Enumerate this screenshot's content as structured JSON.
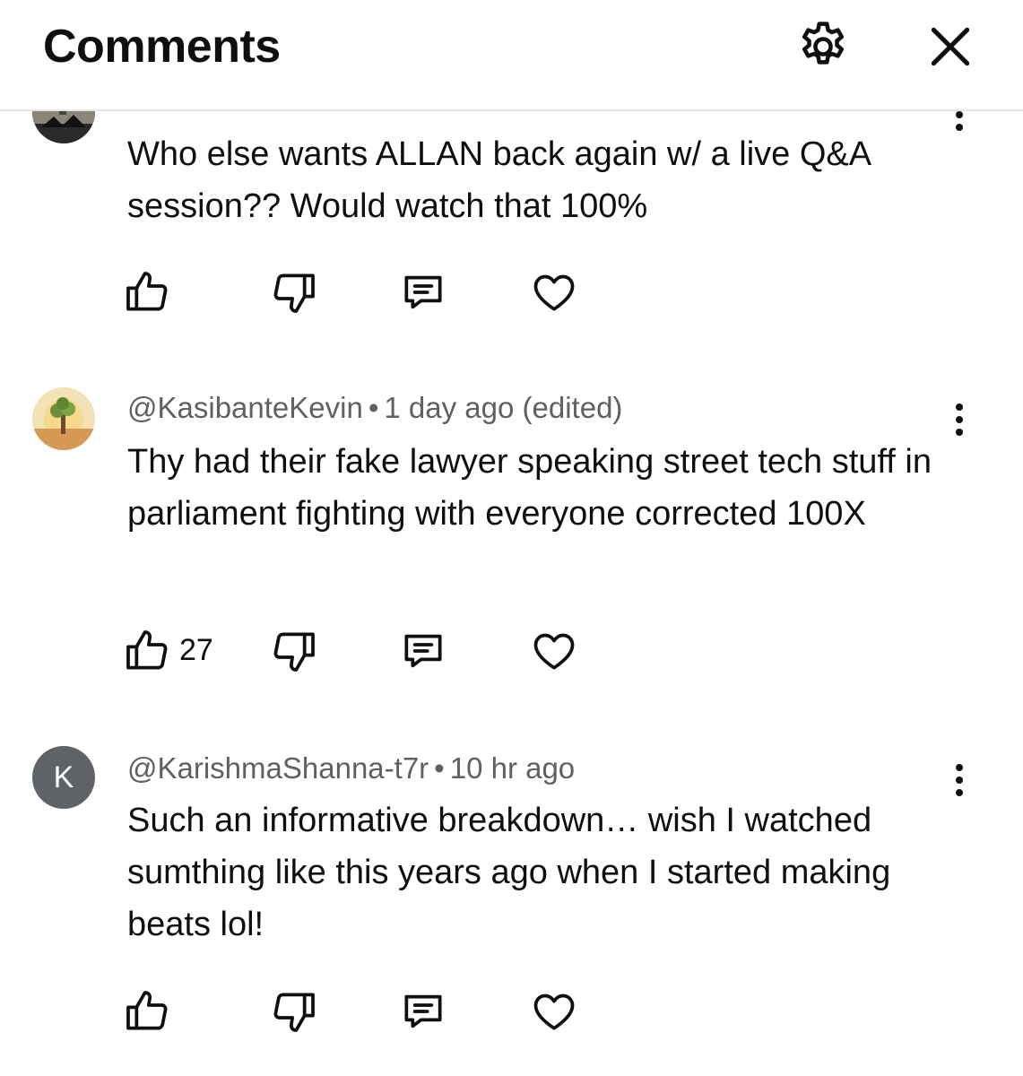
{
  "header": {
    "title": "Comments",
    "settings_icon": "gear-icon",
    "close_icon": "close-icon"
  },
  "comments": [
    {
      "avatar_icon": "dark-photo-avatar",
      "text": "Who else wants ALLAN back again w/ a live Q&A session?? Would watch that 100%",
      "like_count": null
    },
    {
      "avatar_icon": "tree-illustration-avatar",
      "author": "@KasibanteKevin",
      "separator": "•",
      "time": "1 day ago (edited)",
      "text": "Thy had their fake lawyer speaking street tech stuff in parliament fighting with everyone corrected 100X",
      "like_count": "27"
    },
    {
      "avatar_letter": "K",
      "avatar_color": "#5f6368",
      "author": "@KarishmaShanna-t7r",
      "separator": "•",
      "time": "10 hr ago",
      "text": "Such an informative breakdown… wish I watched sumthing like this years ago when I started making beats lol!",
      "like_count": null
    }
  ]
}
